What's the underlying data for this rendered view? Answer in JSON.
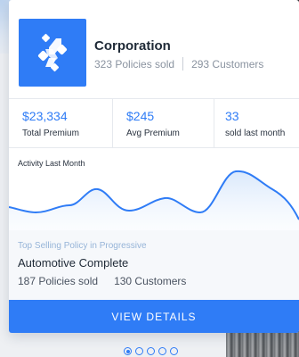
{
  "company": {
    "name": "Corporation",
    "policies_sold": "323 Policies sold",
    "customers": "293 Customers",
    "logo_icon": "molecule-logo-icon"
  },
  "stats": [
    {
      "value": "$23,334",
      "label": "Total Premium"
    },
    {
      "value": "$245",
      "label": "Avg Premium"
    },
    {
      "value": "33",
      "label": "sold last month"
    }
  ],
  "activity": {
    "label": "Activity Last Month"
  },
  "top_policy": {
    "heading": "Top Selling Policy in Progressive",
    "name": "Automotive Complete",
    "policies_sold": "187 Policies sold",
    "customers": "130 Customers"
  },
  "cta": {
    "label": "VIEW DETAILS"
  },
  "pagination": {
    "count": 5,
    "active_index": 0
  },
  "colors": {
    "accent": "#2f7cf6",
    "chart_line": "#2f7cf6",
    "chart_fill": "#e3eefc"
  }
}
